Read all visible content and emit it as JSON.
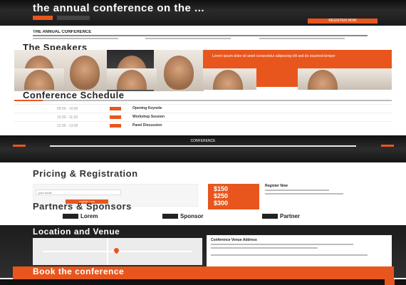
{
  "hero": {
    "title": "the annual conference on the ...",
    "cta": "REGISTER NOW"
  },
  "intro": {
    "heading": "THE ANNUAL CONFERENCE"
  },
  "speakers": {
    "title": "The Speakers",
    "banner_text": "Lorem ipsum dolor sit amet consectetur adipiscing elit sed do eiusmod tempor"
  },
  "schedule": {
    "title": "Conference Schedule",
    "rows": [
      {
        "time": "09:00 - 10:00",
        "title": "Opening Keynote"
      },
      {
        "time": "10:30 - 11:30",
        "title": "Workshop Session"
      },
      {
        "time": "12:00 - 13:00",
        "title": "Panel Discussion"
      }
    ]
  },
  "band": {
    "title": "CONFERENCE"
  },
  "pricing": {
    "title": "Pricing & Registration",
    "input_placeholder": "your email",
    "button": "register now",
    "prices": [
      "$150",
      "$250",
      "$300"
    ],
    "info_title": "Register Now"
  },
  "sponsors": {
    "title": "Partners & Sponsors",
    "items": [
      "Lorem",
      "Sponsor",
      "Partner"
    ]
  },
  "location": {
    "title": "Location and Venue",
    "head": "Conference Venue Address"
  },
  "cta": {
    "title": "Book the conference"
  },
  "colors": {
    "accent": "#e8561d",
    "dark": "#1a1a1a"
  }
}
